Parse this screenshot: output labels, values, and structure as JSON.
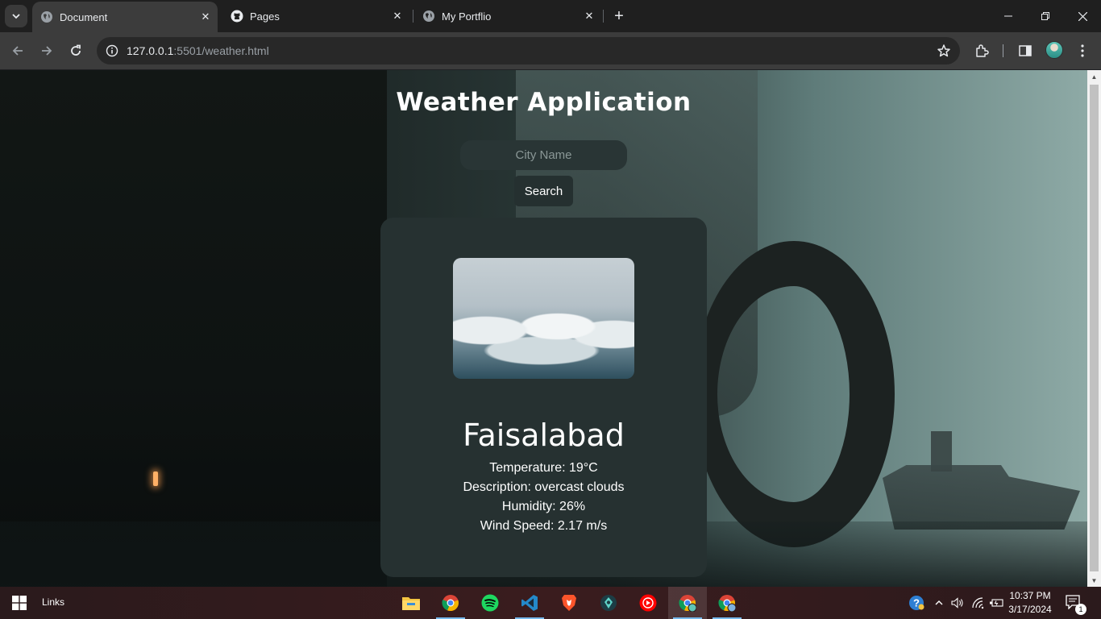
{
  "browser": {
    "tabs": [
      {
        "title": "Document",
        "icon": "globe-icon",
        "active": true
      },
      {
        "title": "Pages",
        "icon": "github-icon",
        "active": false
      },
      {
        "title": "My Portflio",
        "icon": "globe-icon",
        "active": false
      }
    ],
    "address": {
      "host": "127.0.0.1",
      "rest": ":5501/weather.html"
    }
  },
  "page": {
    "title": "Weather Application",
    "city_input_placeholder": "City Name",
    "search_label": "Search"
  },
  "weather": {
    "city": "Faisalabad",
    "temperature": "Temperature: 19°C",
    "description": "Description: overcast clouds",
    "humidity": "Humidity: 26%",
    "wind": "Wind Speed: 2.17 m/s"
  },
  "taskbar": {
    "links_label": "Links",
    "apps": [
      "file-explorer-icon",
      "chrome-icon",
      "spotify-icon",
      "vscode-icon",
      "brave-icon",
      "app-icon",
      "youtube-music-icon",
      "chrome-icon",
      "chrome-icon"
    ],
    "time": "10:37 PM",
    "date": "3/17/2024",
    "notification_count": "1"
  },
  "colors": {
    "card": "#263131",
    "input": "#293535",
    "button": "#253030",
    "accent": "#76b9ed"
  }
}
